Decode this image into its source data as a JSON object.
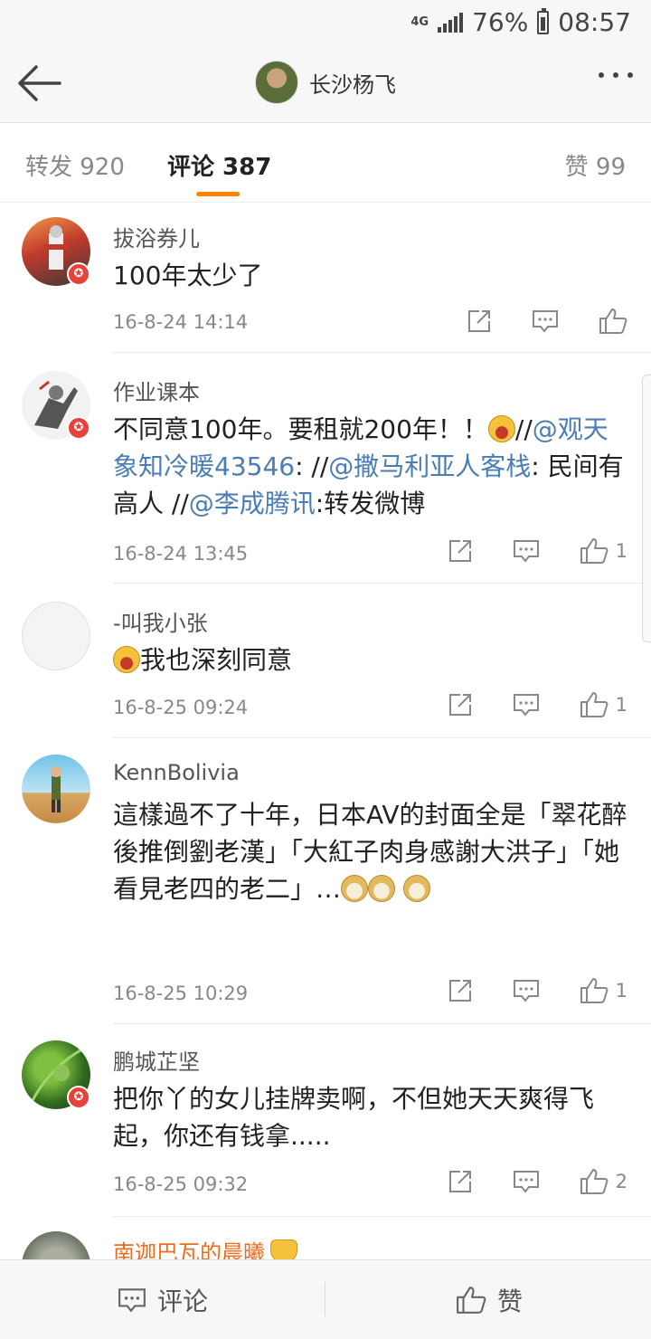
{
  "status_bar": {
    "network": "4G",
    "battery": "76%",
    "time": "08:57"
  },
  "nav": {
    "title": "长沙杨飞"
  },
  "tabs": {
    "forward": "转发 920",
    "comments": "评论 387",
    "likes": "赞 99",
    "active_color": "#ff8200"
  },
  "comments": [
    {
      "name": "拔浴券儿",
      "text": "100年太少了",
      "time": "16-8-24 14:14",
      "likes": "",
      "verified": true
    },
    {
      "name": "作业课本",
      "text_parts": [
        "不同意100年。要租就200年！！",
        "//",
        "@观天象知冷暖43546",
        ": //",
        "@撒马利亚人客栈",
        ": 民间有高人 //",
        "@李成腾讯",
        ":转发微博"
      ],
      "time": "16-8-24 13:45",
      "likes": "1",
      "verified": true
    },
    {
      "name": "-叫我小张",
      "text": "我也深刻同意",
      "time": "16-8-25 09:24",
      "likes": "1",
      "verified": false
    },
    {
      "name": "KennBolivia",
      "text": "這樣過不了十年，日本AV的封面全是「翠花醉後推倒劉老漢」「大紅子肉身感謝大洪子」「她看見老四的老二」…",
      "time": "16-8-25 10:29",
      "likes": "1",
      "verified": false
    },
    {
      "name": "鹏城芷坚",
      "text": "把你丫的女儿挂牌卖啊，不但她天天爽得飞起，你还有钱拿.....",
      "time": "16-8-25 09:32",
      "likes": "2",
      "verified": true
    },
    {
      "name": "南迦巴瓦的晨曦",
      "verified": false
    }
  ],
  "bottom_bar": {
    "comment": "评论",
    "like": "赞"
  },
  "icons": {
    "back": "arrow-left-icon",
    "more": "more-icon",
    "forward": "forward-icon",
    "comment": "comment-icon",
    "like": "thumbs-up-icon",
    "verified": "verified-badge-icon"
  },
  "colors": {
    "link": "#4a7db5",
    "accent": "#ff8200",
    "vip_name": "#f06b1e",
    "badge": "#e6423a"
  }
}
